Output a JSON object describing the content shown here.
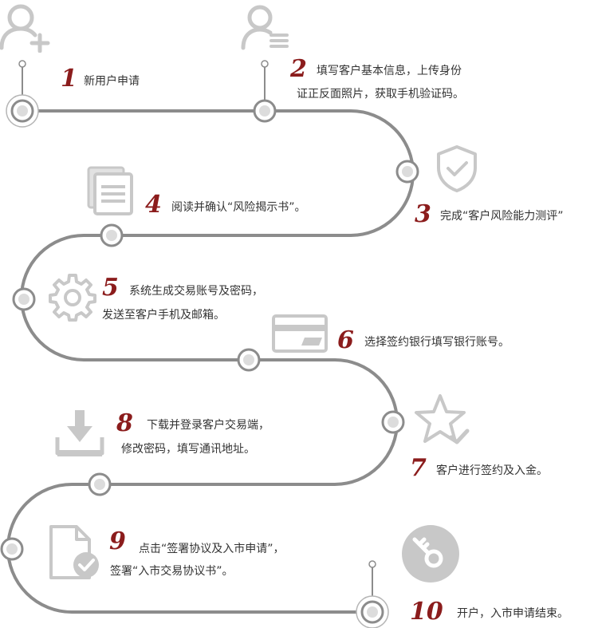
{
  "colors": {
    "track": "#8c8c8c",
    "accent": "#8b1c1c",
    "icon": "#c8c8c8",
    "text": "#333333"
  },
  "steps": [
    {
      "num": "1",
      "line1": "新用户申请",
      "line2": "",
      "icon": "add-user-icon"
    },
    {
      "num": "2",
      "line1": "填写客户基本信息，上传身份",
      "line2": "证正反面照片，获取手机验证码。",
      "icon": "user-list-icon"
    },
    {
      "num": "3",
      "line1": "完成“客户风险能力测评”",
      "line2": "",
      "icon": "shield-check-icon"
    },
    {
      "num": "4",
      "line1": "阅读并确认“风险揭示书”。",
      "line2": "",
      "icon": "documents-icon"
    },
    {
      "num": "5",
      "line1": "系统生成交易账号及密码，",
      "line2": "发送至客户手机及邮箱。",
      "icon": "gear-icon"
    },
    {
      "num": "6",
      "line1": "选择签约银行填写银行账号。",
      "line2": "",
      "icon": "bank-card-icon"
    },
    {
      "num": "7",
      "line1": "客户进行签约及入金。",
      "line2": "",
      "icon": "star-check-icon"
    },
    {
      "num": "8",
      "line1": "下载并登录客户交易端，",
      "line2": "修改密码，填写通讯地址。",
      "icon": "download-icon"
    },
    {
      "num": "9",
      "line1": "点击“签署协议及入市申请”，",
      "line2": "签署“入市交易协议书”。",
      "icon": "document-check-icon"
    },
    {
      "num": "10",
      "line1": "开户，入市申请结束。",
      "line2": "",
      "icon": "key-icon"
    }
  ]
}
